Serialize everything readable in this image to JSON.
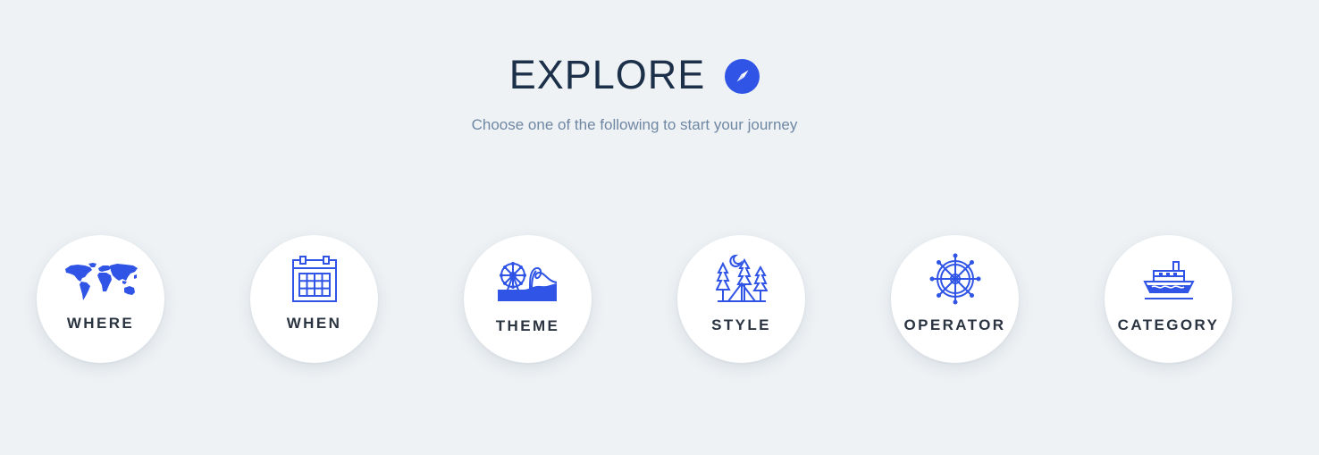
{
  "header": {
    "title": "EXPLORE",
    "subtitle": "Choose one of the following to start your journey",
    "title_icon": "compass-icon"
  },
  "options": [
    {
      "label": "WHERE",
      "icon": "world-map-icon"
    },
    {
      "label": "WHEN",
      "icon": "calendar-icon"
    },
    {
      "label": "THEME",
      "icon": "ferris-wheel-rollercoaster-icon"
    },
    {
      "label": "STYLE",
      "icon": "camping-tent-icon"
    },
    {
      "label": "OPERATOR",
      "icon": "ship-wheel-icon"
    },
    {
      "label": "CATEGORY",
      "icon": "cruise-ship-icon"
    }
  ],
  "colors": {
    "background": "#eef2f5",
    "accent": "#2f54e6",
    "title": "#1d3049",
    "subtitle": "#6f87a3",
    "label": "#2b3441"
  }
}
